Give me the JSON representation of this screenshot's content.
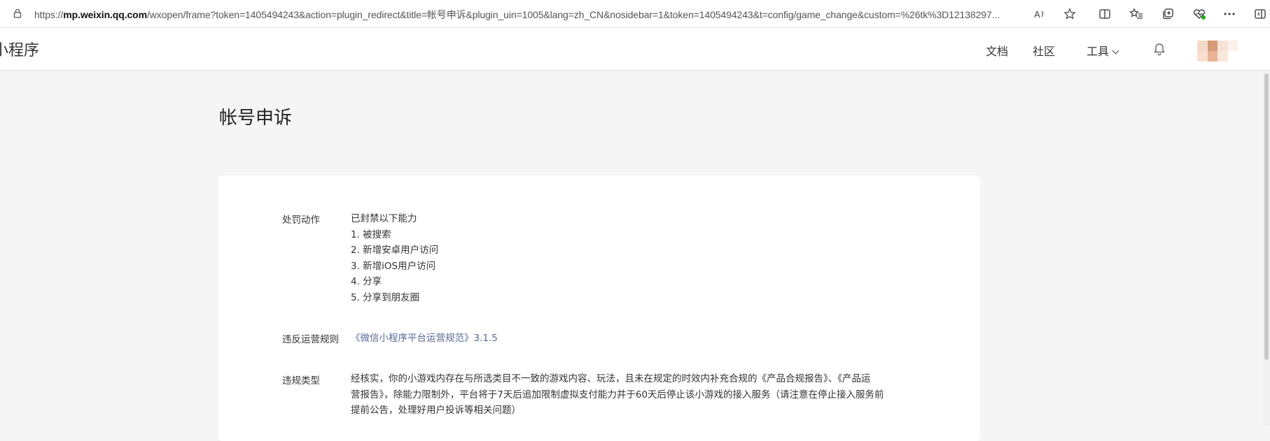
{
  "browser": {
    "url_prefix": "https://",
    "url_host": "mp.weixin.qq.com",
    "url_rest": "/wxopen/frame?token=1405494243&action=plugin_redirect&title=帐号申诉&plugin_uin=1005&lang=zh_CN&nosidebar=1&token=1405494243&t=config/game_change&custom=%26tk%3D12138297..."
  },
  "header": {
    "brand": "小程序",
    "nav": {
      "docs": "文档",
      "community": "社区",
      "tools": "工具"
    }
  },
  "page": {
    "title": "帐号申诉"
  },
  "details": {
    "punishment": {
      "label": "处罚动作",
      "intro": "已封禁以下能力",
      "items": [
        "1. 被搜索",
        "2. 新增安卓用户访问",
        "3. 新增iOS用户访问",
        "4. 分享",
        "5. 分享到朋友圈"
      ]
    },
    "rule": {
      "label": "违反运营规则",
      "link": "《微信小程序平台运营规范》3.1.5"
    },
    "violation": {
      "label": "违规类型",
      "line1": "经核实，你的小游戏内存在与所选类目不一致的游戏内容、玩法，且未在规定的时效内补充合规的《产品合规报告》、《产品运",
      "line2": "营报告》，除能力限制外，平台将于7天后追加限制虚拟支付能力并于60天后停止该小游戏的接入服务（请注意在停止接入服务前",
      "line3": "提前公告，处理好用户投诉等相关问题）"
    }
  },
  "icons": {
    "lock": "lock-icon",
    "read_aloud": "read-aloud-icon",
    "favorite": "star-icon",
    "split": "split-screen-icon",
    "favorites": "favorites-icon",
    "collections": "collections-icon",
    "health": "browser-essentials-icon",
    "more": "more-icon",
    "sidebar": "sidebar-icon",
    "bell": "bell-icon"
  },
  "colors": {
    "link": "#576b95",
    "background": "#f5f5f5",
    "card": "#ffffff"
  }
}
